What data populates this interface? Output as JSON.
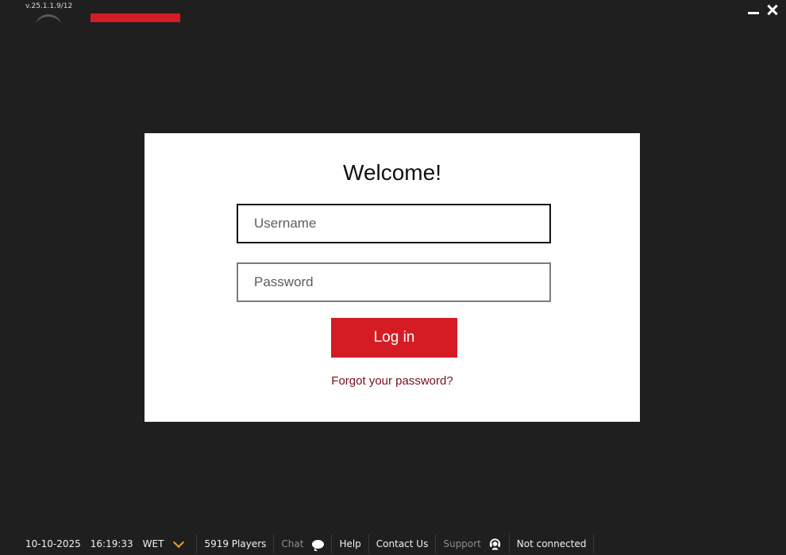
{
  "header": {
    "version": "v.25.1.1.9/12",
    "minimize_icon": "minimize-icon",
    "close_icon": "close-icon"
  },
  "colors": {
    "background": "#1f1f1f",
    "accent": "#d51c25",
    "card": "#ffffff",
    "link": "#7a1016",
    "chevron": "#e8a323"
  },
  "login": {
    "title": "Welcome!",
    "username_placeholder": "Username",
    "password_placeholder": "Password",
    "login_label": "Log in",
    "forgot_label": "Forgot your password?"
  },
  "status_bar": {
    "date": "10-10-2025",
    "time": "16:19:33",
    "timezone": "WET",
    "players": "5919 Players",
    "chat_label": "Chat",
    "help_label": "Help",
    "contact_label": "Contact Us",
    "support_label": "Support",
    "connection_status": "Not connected",
    "icons": [
      "chevron-down-icon",
      "chat-bubble-icon",
      "headset-icon"
    ]
  }
}
